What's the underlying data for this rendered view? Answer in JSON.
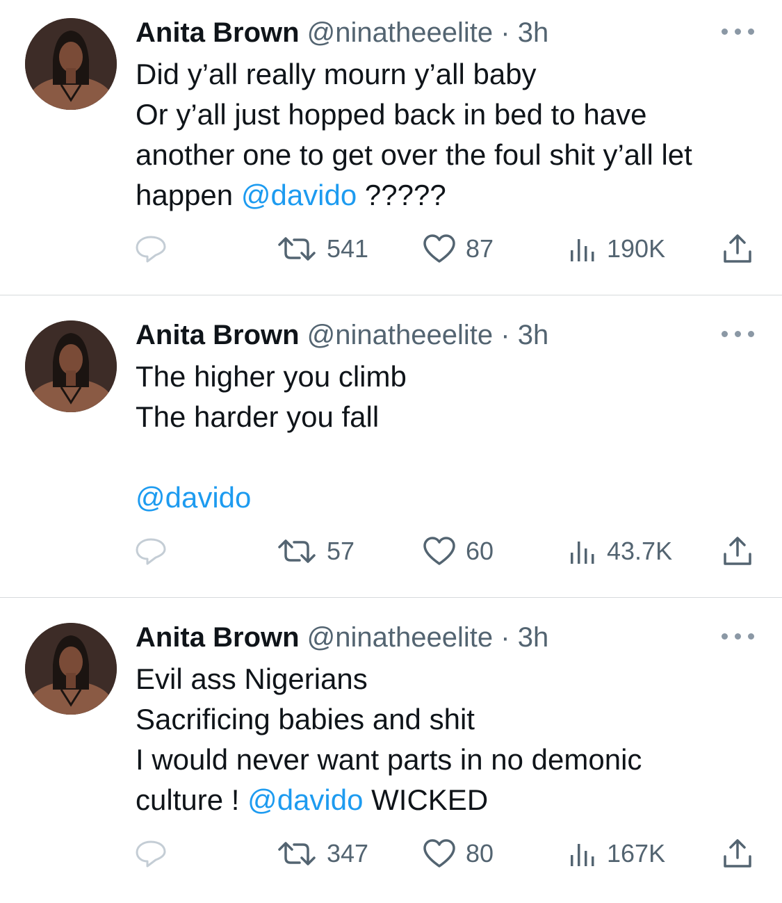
{
  "tweets": [
    {
      "author_name": "Anita Brown",
      "handle": "@ninatheeelite",
      "separator": "·",
      "time": "3h",
      "lines": [
        [
          "Did y’all really mourn y’all baby",
          "",
          ""
        ],
        [
          "Or y’all just hopped back in bed to have",
          "",
          ""
        ],
        [
          "another one to get over the foul shit y’all let",
          "",
          ""
        ],
        [
          "happen ",
          "@davido",
          " ?????"
        ]
      ],
      "stats": {
        "retweets": "541",
        "likes": "87",
        "views": "190K"
      }
    },
    {
      "author_name": "Anita Brown",
      "handle": "@ninatheeelite",
      "separator": "·",
      "time": "3h",
      "lines": [
        [
          "The higher you climb",
          "",
          ""
        ],
        [
          "The harder you fall",
          "",
          ""
        ],
        [
          "",
          "",
          ""
        ],
        [
          "",
          "@davido",
          ""
        ]
      ],
      "stats": {
        "retweets": "57",
        "likes": "60",
        "views": "43.7K"
      }
    },
    {
      "author_name": "Anita Brown",
      "handle": "@ninatheeelite",
      "separator": "·",
      "time": "3h",
      "lines": [
        [
          "Evil ass Nigerians",
          "",
          ""
        ],
        [
          "Sacrificing babies and shit",
          "",
          ""
        ],
        [
          "I would never want parts in no demonic",
          "",
          ""
        ],
        [
          "culture ! ",
          "@davido",
          " WICKED"
        ]
      ],
      "stats": {
        "retweets": "347",
        "likes": "80",
        "views": "167K"
      }
    }
  ],
  "icons": {
    "reply": "reply-icon",
    "retweet": "retweet-icon",
    "like": "like-icon",
    "views": "views-icon",
    "share": "share-icon",
    "more": "more-icon"
  },
  "colors": {
    "text": "#0f1419",
    "secondary": "#536471",
    "mention": "#1d9bf0",
    "divider": "#d6d9dc"
  }
}
